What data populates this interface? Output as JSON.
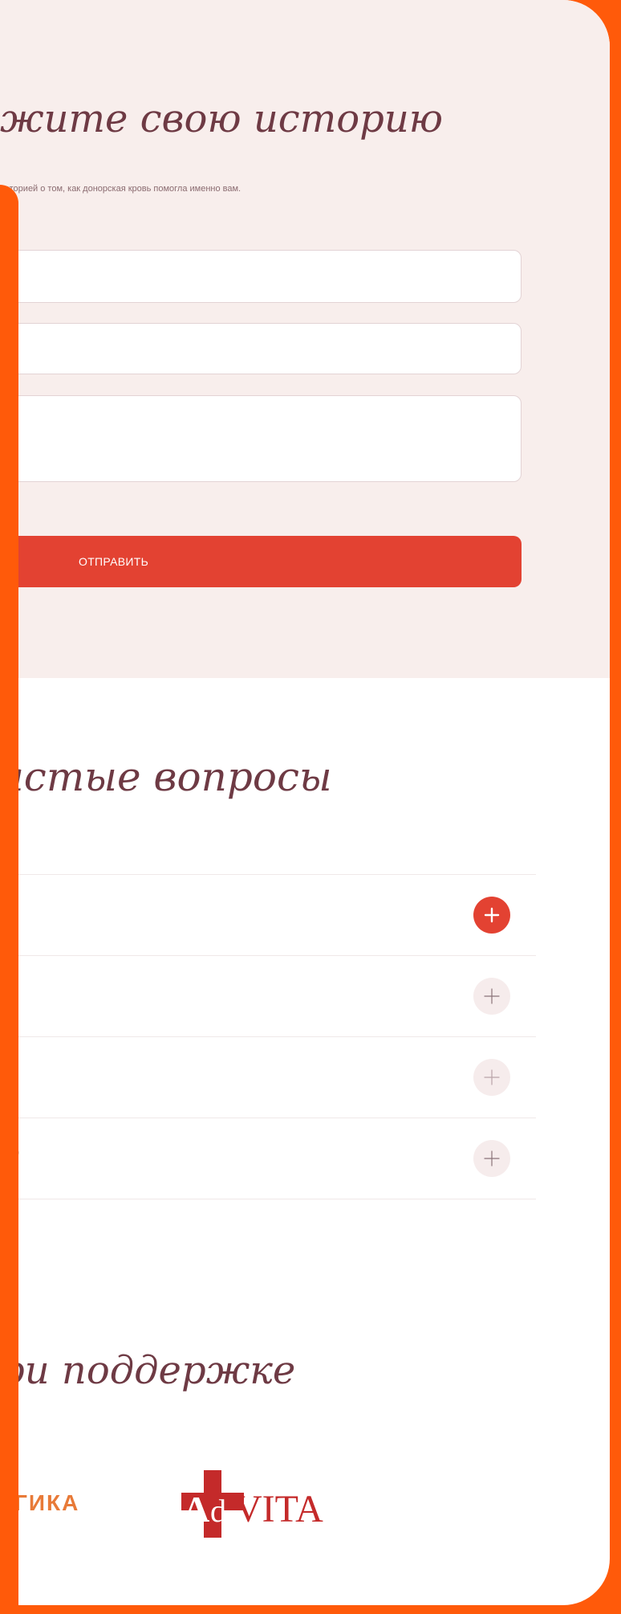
{
  "story": {
    "title": "жите свою историю",
    "subtitle": "историей о том, как донорская кровь помогла именно вам.",
    "name_value": "",
    "contact_value": "",
    "story_value": "",
    "submit_label": "ОТПРАВИТЬ"
  },
  "faq": {
    "title": "астые вопросы",
    "items": [
      {
        "question": "",
        "expanded": true
      },
      {
        "question": "",
        "expanded": false
      },
      {
        "question": "",
        "expanded": false
      },
      {
        "question": "?",
        "expanded": false
      }
    ]
  },
  "support": {
    "title": "ри поддержке",
    "partners": [
      {
        "name": "ГИКА"
      },
      {
        "name": "AdVITA"
      }
    ]
  },
  "colors": {
    "accent": "#e34232",
    "frame": "#ff5a0a",
    "section_bg": "#f8eeec",
    "heading": "#6e3a44"
  }
}
